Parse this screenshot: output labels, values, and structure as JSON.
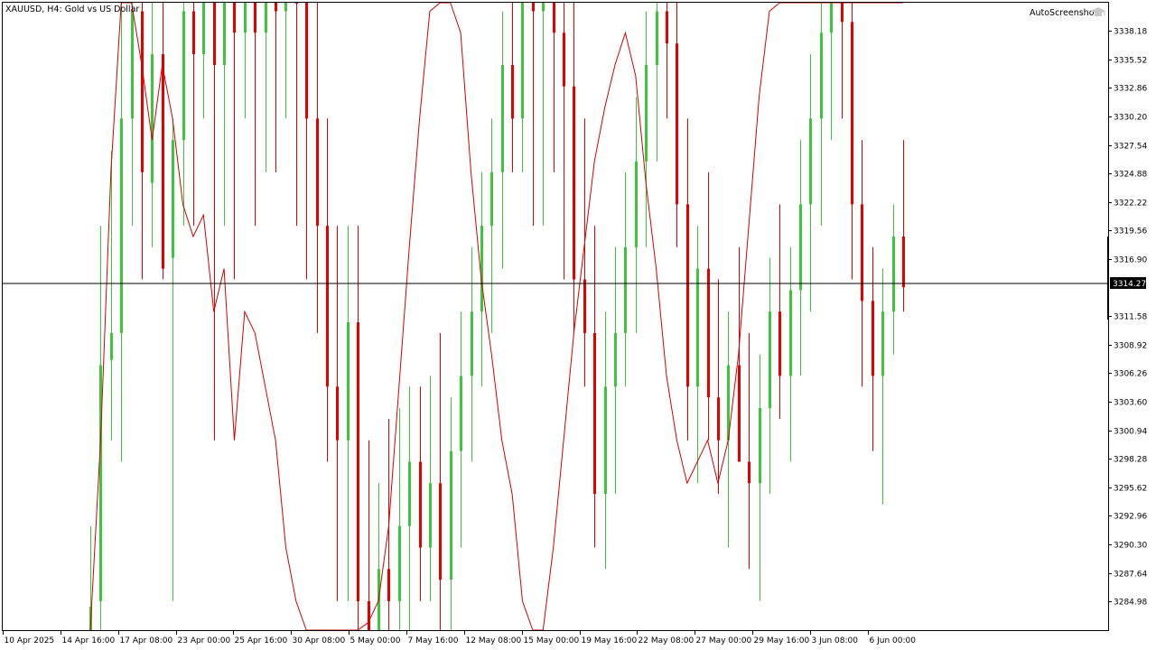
{
  "chart_title": "XAUUSD, H4:  Gold vs US Dollar",
  "watermark_label": "AutoScreenshot",
  "watermark_icon": "graduation-cap-icon",
  "colors": {
    "background": "#ffffff",
    "bull": "#3ec53e",
    "bear": "#e50000",
    "ma_line": "#d40000",
    "crosshair": "#000000",
    "axis": "#000000",
    "price_badge": "#000000"
  },
  "chart_data": {
    "type": "candlestick",
    "symbol": "XAUUSD",
    "timeframe": "H4",
    "title": "XAUUSD, H4:  Gold vs US Dollar",
    "ylim": [
      3282.3,
      3340.8
    ],
    "grid": false,
    "current_price": "3314.27",
    "y_ticks": [
      "3338.18",
      "3335.52",
      "3332.86",
      "3330.20",
      "3327.54",
      "3324.88",
      "3322.22",
      "3319.56",
      "3316.90",
      "3311.58",
      "3308.92",
      "3306.26",
      "3303.60",
      "3300.94",
      "3298.28",
      "3295.62",
      "3292.96",
      "3290.30",
      "3287.64",
      "3284.98"
    ],
    "x_ticks": [
      "10 Apr 2025",
      "14 Apr 16:00",
      "17 Apr 08:00",
      "23 Apr 00:00",
      "25 Apr 16:00",
      "30 Apr 08:00",
      "5 May 00:00",
      "7 May 16:00",
      "12 May 08:00",
      "15 May 00:00",
      "19 May 16:00",
      "22 May 08:00",
      "27 May 00:00",
      "29 May 16:00",
      "3 Jun 08:00",
      "6 Jun 00:00"
    ],
    "candles": [
      {
        "o": 3282.0,
        "h": 3292.0,
        "l": 3280.0,
        "c": 3284.5
      },
      {
        "o": 3285.0,
        "h": 3320.0,
        "l": 3282.0,
        "c": 3307.0
      },
      {
        "o": 3307.5,
        "h": 3327.0,
        "l": 3300.0,
        "c": 3310.0
      },
      {
        "o": 3310.0,
        "h": 3342.0,
        "l": 3298.0,
        "c": 3330.0
      },
      {
        "o": 3330.0,
        "h": 3345.0,
        "l": 3320.0,
        "c": 3340.0
      },
      {
        "o": 3340.0,
        "h": 3345.0,
        "l": 3315.0,
        "c": 3325.0
      },
      {
        "o": 3324.0,
        "h": 3345.0,
        "l": 3318.0,
        "c": 3336.0
      },
      {
        "o": 3336.0,
        "h": 3345.0,
        "l": 3315.0,
        "c": 3316.0
      },
      {
        "o": 3317.0,
        "h": 3330.0,
        "l": 3285.0,
        "c": 3328.0
      },
      {
        "o": 3328.0,
        "h": 3345.0,
        "l": 3320.0,
        "c": 3340.0
      },
      {
        "o": 3340.0,
        "h": 3345.0,
        "l": 3320.0,
        "c": 3336.0
      },
      {
        "o": 3336.0,
        "h": 3345.0,
        "l": 3330.0,
        "c": 3342.0
      },
      {
        "o": 3342.0,
        "h": 3345.0,
        "l": 3300.0,
        "c": 3335.0
      },
      {
        "o": 3335.0,
        "h": 3345.0,
        "l": 3320.0,
        "c": 3342.0
      },
      {
        "o": 3342.0,
        "h": 3345.0,
        "l": 3315.0,
        "c": 3338.0
      },
      {
        "o": 3338.0,
        "h": 3345.0,
        "l": 3330.0,
        "c": 3341.0
      },
      {
        "o": 3341.0,
        "h": 3345.0,
        "l": 3320.0,
        "c": 3338.0
      },
      {
        "o": 3338.0,
        "h": 3345.0,
        "l": 3325.0,
        "c": 3342.0
      },
      {
        "o": 3342.0,
        "h": 3345.0,
        "l": 3325.0,
        "c": 3340.0
      },
      {
        "o": 3340.0,
        "h": 3345.0,
        "l": 3330.0,
        "c": 3343.0
      },
      {
        "o": 3343.0,
        "h": 3345.0,
        "l": 3320.0,
        "c": 3341.0
      },
      {
        "o": 3341.0,
        "h": 3345.0,
        "l": 3315.0,
        "c": 3330.0
      },
      {
        "o": 3330.0,
        "h": 3345.0,
        "l": 3310.0,
        "c": 3320.0
      },
      {
        "o": 3320.0,
        "h": 3330.0,
        "l": 3298.0,
        "c": 3305.0
      },
      {
        "o": 3305.0,
        "h": 3320.0,
        "l": 3285.0,
        "c": 3300.0
      },
      {
        "o": 3300.0,
        "h": 3320.0,
        "l": 3285.0,
        "c": 3311.0
      },
      {
        "o": 3311.0,
        "h": 3320.0,
        "l": 3280.0,
        "c": 3285.0
      },
      {
        "o": 3285.0,
        "h": 3300.0,
        "l": 3280.0,
        "c": 3282.0
      },
      {
        "o": 3282.0,
        "h": 3296.0,
        "l": 3280.0,
        "c": 3288.0
      },
      {
        "o": 3288.0,
        "h": 3302.0,
        "l": 3280.0,
        "c": 3285.0
      },
      {
        "o": 3285.0,
        "h": 3303.0,
        "l": 3280.0,
        "c": 3292.0
      },
      {
        "o": 3292.0,
        "h": 3305.0,
        "l": 3280.0,
        "c": 3298.0
      },
      {
        "o": 3298.0,
        "h": 3305.0,
        "l": 3285.0,
        "c": 3290.0
      },
      {
        "o": 3290.0,
        "h": 3306.0,
        "l": 3285.0,
        "c": 3296.0
      },
      {
        "o": 3296.0,
        "h": 3310.0,
        "l": 3282.0,
        "c": 3287.0
      },
      {
        "o": 3287.0,
        "h": 3304.0,
        "l": 3280.0,
        "c": 3299.0
      },
      {
        "o": 3299.0,
        "h": 3312.0,
        "l": 3290.0,
        "c": 3306.0
      },
      {
        "o": 3306.0,
        "h": 3318.0,
        "l": 3298.0,
        "c": 3312.0
      },
      {
        "o": 3312.0,
        "h": 3325.0,
        "l": 3305.0,
        "c": 3320.0
      },
      {
        "o": 3320.0,
        "h": 3330.0,
        "l": 3310.0,
        "c": 3325.0
      },
      {
        "o": 3325.0,
        "h": 3340.0,
        "l": 3316.0,
        "c": 3335.0
      },
      {
        "o": 3335.0,
        "h": 3345.0,
        "l": 3325.0,
        "c": 3330.0
      },
      {
        "o": 3330.0,
        "h": 3345.0,
        "l": 3325.0,
        "c": 3342.0
      },
      {
        "o": 3342.0,
        "h": 3345.0,
        "l": 3320.0,
        "c": 3340.0
      },
      {
        "o": 3340.0,
        "h": 3345.0,
        "l": 3320.0,
        "c": 3342.0
      },
      {
        "o": 3342.0,
        "h": 3345.0,
        "l": 3325.0,
        "c": 3338.0
      },
      {
        "o": 3338.0,
        "h": 3345.0,
        "l": 3315.0,
        "c": 3333.0
      },
      {
        "o": 3333.0,
        "h": 3345.0,
        "l": 3310.0,
        "c": 3315.0
      },
      {
        "o": 3315.0,
        "h": 3330.0,
        "l": 3305.0,
        "c": 3310.0
      },
      {
        "o": 3310.0,
        "h": 3320.0,
        "l": 3290.0,
        "c": 3295.0
      },
      {
        "o": 3295.0,
        "h": 3312.0,
        "l": 3288.0,
        "c": 3305.0
      },
      {
        "o": 3305.0,
        "h": 3318.0,
        "l": 3295.0,
        "c": 3310.0
      },
      {
        "o": 3310.0,
        "h": 3325.0,
        "l": 3305.0,
        "c": 3318.0
      },
      {
        "o": 3318.0,
        "h": 3332.0,
        "l": 3310.0,
        "c": 3326.0
      },
      {
        "o": 3326.0,
        "h": 3340.0,
        "l": 3318.0,
        "c": 3335.0
      },
      {
        "o": 3335.0,
        "h": 3345.0,
        "l": 3326.0,
        "c": 3340.0
      },
      {
        "o": 3340.0,
        "h": 3345.0,
        "l": 3330.0,
        "c": 3337.0
      },
      {
        "o": 3337.0,
        "h": 3345.0,
        "l": 3318.0,
        "c": 3322.0
      },
      {
        "o": 3322.0,
        "h": 3330.0,
        "l": 3300.0,
        "c": 3305.0
      },
      {
        "o": 3305.0,
        "h": 3320.0,
        "l": 3296.0,
        "c": 3316.0
      },
      {
        "o": 3316.0,
        "h": 3325.0,
        "l": 3300.0,
        "c": 3304.0
      },
      {
        "o": 3304.0,
        "h": 3315.0,
        "l": 3295.0,
        "c": 3300.0
      },
      {
        "o": 3300.0,
        "h": 3312.0,
        "l": 3290.0,
        "c": 3307.0
      },
      {
        "o": 3307.0,
        "h": 3318.0,
        "l": 3298.0,
        "c": 3298.0
      },
      {
        "o": 3298.0,
        "h": 3310.0,
        "l": 3288.0,
        "c": 3296.0
      },
      {
        "o": 3296.0,
        "h": 3308.0,
        "l": 3285.0,
        "c": 3303.0
      },
      {
        "o": 3303.0,
        "h": 3317.0,
        "l": 3295.0,
        "c": 3312.0
      },
      {
        "o": 3312.0,
        "h": 3322.0,
        "l": 3302.0,
        "c": 3306.0
      },
      {
        "o": 3306.0,
        "h": 3318.0,
        "l": 3298.0,
        "c": 3314.0
      },
      {
        "o": 3314.0,
        "h": 3328.0,
        "l": 3306.0,
        "c": 3322.0
      },
      {
        "o": 3322.0,
        "h": 3336.0,
        "l": 3312.0,
        "c": 3330.0
      },
      {
        "o": 3330.0,
        "h": 3345.0,
        "l": 3320.0,
        "c": 3338.0
      },
      {
        "o": 3338.0,
        "h": 3345.0,
        "l": 3328.0,
        "c": 3342.0
      },
      {
        "o": 3342.0,
        "h": 3345.0,
        "l": 3330.0,
        "c": 3339.0
      },
      {
        "o": 3339.0,
        "h": 3345.0,
        "l": 3315.0,
        "c": 3322.0
      },
      {
        "o": 3322.0,
        "h": 3328.0,
        "l": 3305.0,
        "c": 3313.0
      },
      {
        "o": 3313.0,
        "h": 3318.0,
        "l": 3299.0,
        "c": 3306.0
      },
      {
        "o": 3306.0,
        "h": 3316.0,
        "l": 3294.0,
        "c": 3312.0
      },
      {
        "o": 3312.0,
        "h": 3322.0,
        "l": 3308.0,
        "c": 3319.0
      },
      {
        "o": 3319.0,
        "h": 3328.0,
        "l": 3312.0,
        "c": 3314.27
      }
    ],
    "ma_line": {
      "type": "line",
      "values": [
        3278,
        3300,
        3325,
        3342,
        3342,
        3335,
        3328,
        3335,
        3330,
        3322,
        3319,
        3321,
        3312,
        3316,
        3300,
        3312,
        3310,
        3305,
        3300,
        3290,
        3285,
        3282,
        3280,
        3280,
        3282,
        3280,
        3282,
        3283,
        3285,
        3292,
        3305,
        3318,
        3330,
        3340,
        3345,
        3342,
        3338,
        3325,
        3315,
        3308,
        3300,
        3295,
        3285,
        3280,
        3282,
        3290,
        3300,
        3310,
        3318,
        3326,
        3331,
        3335,
        3338,
        3334,
        3324,
        3316,
        3306,
        3300,
        3296,
        3298,
        3300,
        3296,
        3300,
        3308,
        3320,
        3332,
        3340,
        3345,
        3345,
        3345,
        3345,
        3345,
        3345,
        3345,
        3345,
        3345,
        3345,
        3345,
        3345,
        3345
      ]
    }
  }
}
